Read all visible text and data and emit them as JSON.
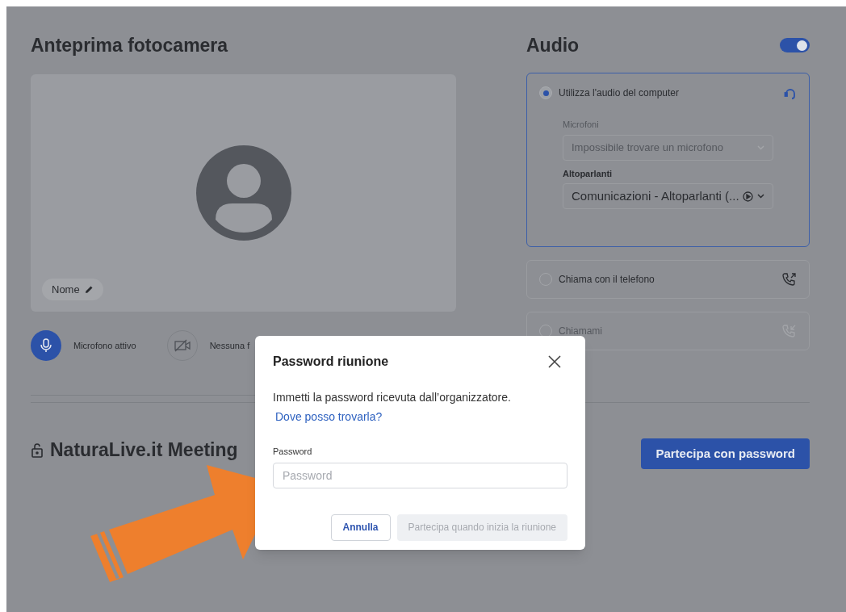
{
  "camera_preview": {
    "title": "Anteprima fotocamera",
    "name_label": "Nome"
  },
  "controls": [
    {
      "kind": "microphone",
      "label": "Microfono attivo",
      "on": true
    },
    {
      "kind": "camera",
      "label": "Nessuna f",
      "on": false
    }
  ],
  "audio": {
    "title": "Audio",
    "enabled": true,
    "options": [
      {
        "kind": "computer",
        "label": "Utilizza l'audio del computer",
        "selected": true,
        "disabled": false,
        "microphones": {
          "label": "Microfoni",
          "value": "Impossibile trovare un microfono",
          "disabled": true
        },
        "speakers": {
          "label": "Altoparlanti",
          "value": "Comunicazioni - Altoparlanti (..."
        }
      },
      {
        "kind": "phone",
        "label": "Chiama con il telefono",
        "selected": false,
        "disabled": false
      },
      {
        "kind": "callback",
        "label": "Chiamami",
        "selected": false,
        "disabled": true
      }
    ]
  },
  "meeting": {
    "title": "NaturaLive.it Meeting",
    "join_button": "Partecipa con password"
  },
  "dialog": {
    "title": "Password riunione",
    "message": "Immetti la password ricevuta dall’organizzatore.",
    "help_link": "Dove posso trovarla?",
    "password_label": "Password",
    "password_placeholder": "Password",
    "buttons": [
      {
        "label": "Annulla",
        "disabled": false
      },
      {
        "label": "Partecipa quando inizia la riunione",
        "disabled": true
      }
    ]
  }
}
